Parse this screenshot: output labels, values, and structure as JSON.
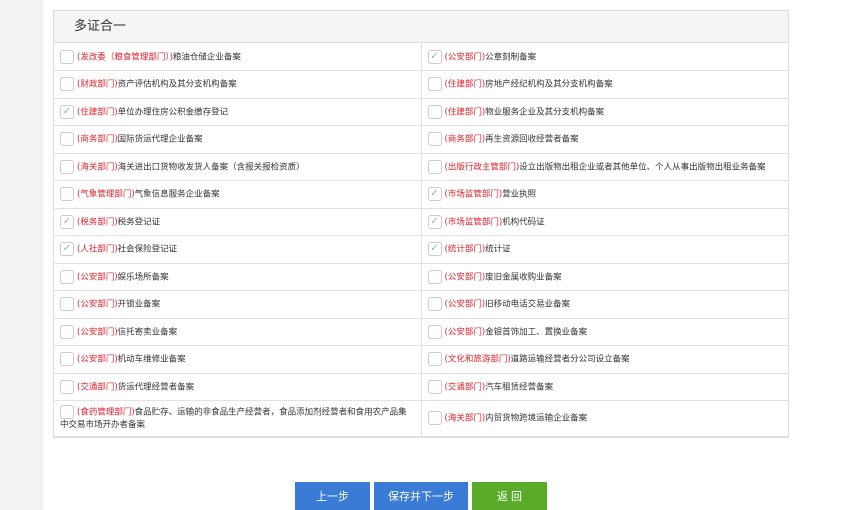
{
  "panel": {
    "title": "多证合一"
  },
  "left": [
    {
      "dept": "(发改委（粮食管理部门）)",
      "name": "粮油仓储企业备案",
      "checked": false
    },
    {
      "dept": "(财政部门)",
      "name": "资产评估机构及其分支机构备案",
      "checked": false
    },
    {
      "dept": "(住建部门)",
      "name": "单位办理住房公积金缴存登记",
      "checked": true
    },
    {
      "dept": "(商务部门)",
      "name": "国际货运代理企业备案",
      "checked": false
    },
    {
      "dept": "(海关部门)",
      "name": "海关进出口货物收发货人备案（含报关报检资质）",
      "checked": false
    },
    {
      "dept": "(气象管理部门)",
      "name": "气象信息服务企业备案",
      "checked": false
    },
    {
      "dept": "(税务部门)",
      "name": "税务登记证",
      "checked": true
    },
    {
      "dept": "(人社部门)",
      "name": "社会保险登记证",
      "checked": true
    },
    {
      "dept": "(公安部门)",
      "name": "娱乐场所备案",
      "checked": false
    },
    {
      "dept": "(公安部门)",
      "name": "开锁业备案",
      "checked": false
    },
    {
      "dept": "(公安部门)",
      "name": "信托寄卖业备案",
      "checked": false
    },
    {
      "dept": "(公安部门)",
      "name": "机动车维修业备案",
      "checked": false
    },
    {
      "dept": "(交通部门)",
      "name": "货运代理经营者备案",
      "checked": false
    },
    {
      "dept": "(食药管理部门)",
      "name": "食品贮存、运输的非食品生产经营者，食品添加剂经营者和食用农产品集中交易市场开办者备案",
      "checked": false
    }
  ],
  "right": [
    {
      "dept": "(公安部门)",
      "name": "公章刻制备案",
      "checked": true
    },
    {
      "dept": "(住建部门)",
      "name": "房地产经纪机构及其分支机构备案",
      "checked": false
    },
    {
      "dept": "(住建部门)",
      "name": "物业服务企业及其分支机构备案",
      "checked": false
    },
    {
      "dept": "(商务部门)",
      "name": "再生资源回收经营者备案",
      "checked": false
    },
    {
      "dept": "(出版行政主管部门)",
      "name": "设立出版物出租企业或者其他单位、个人从事出版物出租业务备案",
      "checked": false
    },
    {
      "dept": "(市场监管部门)",
      "name": "营业执照",
      "checked": true
    },
    {
      "dept": "(市场监管部门)",
      "name": "机构代码证",
      "checked": true
    },
    {
      "dept": "(统计部门)",
      "name": "统计证",
      "checked": true
    },
    {
      "dept": "(公安部门)",
      "name": "废旧金属收购业备案",
      "checked": false
    },
    {
      "dept": "(公安部门)",
      "name": "旧移动电话交易业备案",
      "checked": false
    },
    {
      "dept": "(公安部门)",
      "name": "金银首饰加工、置换业备案",
      "checked": false
    },
    {
      "dept": "(文化和旅游部门)",
      "name": "道路运输经营者分公司设立备案",
      "checked": false
    },
    {
      "dept": "(交通部门)",
      "name": "汽车租赁经营备案",
      "checked": false
    },
    {
      "dept": "(海关部门)",
      "name": "内贸货物跨境运输企业备案",
      "checked": false
    }
  ],
  "buttons": {
    "prev": "上一步",
    "save_next": "保存并下一步",
    "back": "返 回"
  }
}
